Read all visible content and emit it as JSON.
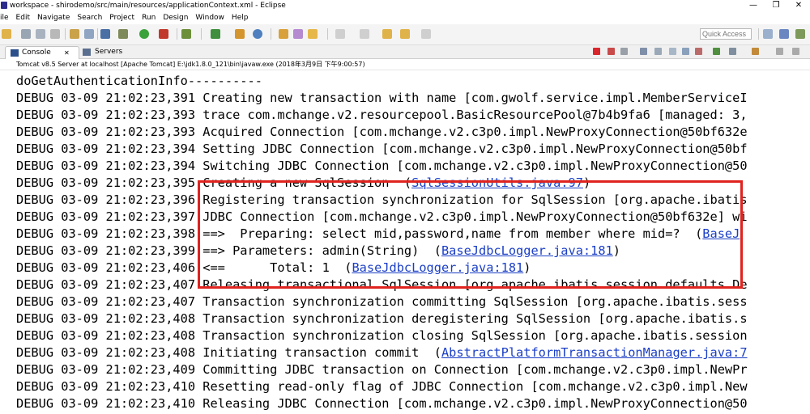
{
  "window": {
    "title": "workspace - shirodemo/src/main/resources/applicationContext.xml - Eclipse",
    "minimize": "—",
    "restore": "❐",
    "close": "✕"
  },
  "menu": [
    "ile",
    "Edit",
    "Navigate",
    "Search",
    "Project",
    "Run",
    "Design",
    "Window",
    "Help"
  ],
  "toolbar": {
    "quick_access": "Quick Access"
  },
  "views": {
    "console_tab": "Console",
    "console_close": "✕",
    "servers_tab": "Servers"
  },
  "process_path": "Tomcat v8.5 Server at localhost [Apache Tomcat] E:\\jdk1.8.0_121\\bin\\javaw.exe (2018年3月9日 下午9:00:57)",
  "console_lines": [
    {
      "text": "doGetAuthenticationInfo----------",
      "link": ""
    },
    {
      "text": "DEBUG 03-09 21:02:23,391 Creating new transaction with name [com.gwolf.service.impl.MemberServiceI",
      "link": ""
    },
    {
      "text": "DEBUG 03-09 21:02:23,393 trace com.mchange.v2.resourcepool.BasicResourcePool@7b4b9fa6 [managed: 3,",
      "link": ""
    },
    {
      "text": "DEBUG 03-09 21:02:23,393 Acquired Connection [com.mchange.v2.c3p0.impl.NewProxyConnection@50bf632e",
      "link": ""
    },
    {
      "text": "DEBUG 03-09 21:02:23,394 Setting JDBC Connection [com.mchange.v2.c3p0.impl.NewProxyConnection@50bf",
      "link": ""
    },
    {
      "text": "DEBUG 03-09 21:02:23,394 Switching JDBC Connection [com.mchange.v2.c3p0.impl.NewProxyConnection@50",
      "link": ""
    },
    {
      "text": "DEBUG 03-09 21:02:23,395 Creating a new SqlSession  (",
      "link": "SqlSessionUtils.java:97",
      "after": ")"
    },
    {
      "text": "DEBUG 03-09 21:02:23,396 Registering transaction synchronization for SqlSession [org.apache.ibatis",
      "link": ""
    },
    {
      "text": "DEBUG 03-09 21:02:23,397 JDBC Connection [com.mchange.v2.c3p0.impl.NewProxyConnection@50bf632e] wi",
      "link": ""
    },
    {
      "text": "DEBUG 03-09 21:02:23,398 ==>  Preparing: select mid,password,name from member where mid=?  (",
      "link": "BaseJ",
      "after": ""
    },
    {
      "text": "DEBUG 03-09 21:02:23,399 ==> Parameters: admin(String)  (",
      "link": "BaseJdbcLogger.java:181",
      "after": ")"
    },
    {
      "text": "DEBUG 03-09 21:02:23,406 <==      Total: 1  (",
      "link": "BaseJdbcLogger.java:181",
      "after": ")"
    },
    {
      "text": "DEBUG 03-09 21:02:23,407 Releasing transactional SqlSession [org.apache.ibatis.session.defaults.De",
      "link": ""
    },
    {
      "text": "DEBUG 03-09 21:02:23,407 Transaction synchronization committing SqlSession [org.apache.ibatis.sess",
      "link": ""
    },
    {
      "text": "DEBUG 03-09 21:02:23,408 Transaction synchronization deregistering SqlSession [org.apache.ibatis.s",
      "link": ""
    },
    {
      "text": "DEBUG 03-09 21:02:23,408 Transaction synchronization closing SqlSession [org.apache.ibatis.session",
      "link": ""
    },
    {
      "text": "DEBUG 03-09 21:02:23,408 Initiating transaction commit  (",
      "link": "AbstractPlatformTransactionManager.java:7",
      "after": ""
    },
    {
      "text": "DEBUG 03-09 21:02:23,409 Committing JDBC transaction on Connection [com.mchange.v2.c3p0.impl.NewPr",
      "link": ""
    },
    {
      "text": "DEBUG 03-09 21:02:23,410 Resetting read-only flag of JDBC Connection [com.mchange.v2.c3p0.impl.New",
      "link": ""
    },
    {
      "text": "DEBUG 03-09 21:02:23,410 Releasing JDBC Connection [com.mchange.v2.c3p0.impl.NewProxyConnection@50",
      "link": ""
    }
  ],
  "colors": {
    "highlight_box": "#e0231e",
    "link": "#1a3ec6",
    "terminate_button": "#d9262c"
  }
}
